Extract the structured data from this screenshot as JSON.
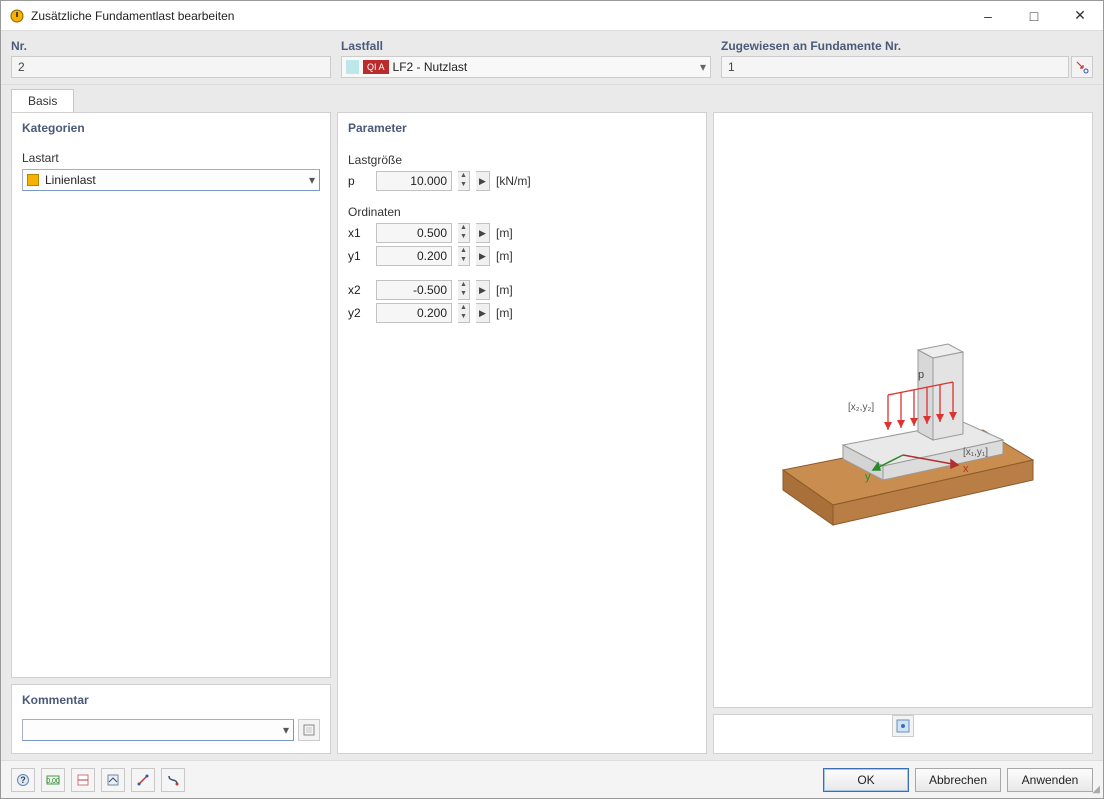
{
  "window": {
    "title": "Zusätzliche Fundamentlast bearbeiten"
  },
  "header": {
    "nr_label": "Nr.",
    "nr_value": "2",
    "lastfall_label": "Lastfall",
    "lastfall_badge": "QI A",
    "lastfall_value": "LF2 - Nutzlast",
    "assign_label": "Zugewiesen an Fundamente Nr.",
    "assign_value": "1"
  },
  "tabs": {
    "basis": "Basis"
  },
  "categories": {
    "heading": "Kategorien",
    "lastart_label": "Lastart",
    "lastart_value": "Linienlast"
  },
  "parameters": {
    "heading": "Parameter",
    "lastgroesse_label": "Lastgröße",
    "p_label": "p",
    "p_value": "10.000",
    "p_unit": "[kN/m]",
    "ordinaten_label": "Ordinaten",
    "x1_label": "x1",
    "x1_value": "0.500",
    "y1_label": "y1",
    "y1_value": "0.200",
    "x2_label": "x2",
    "x2_value": "-0.500",
    "y2_label": "y2",
    "y2_value": "0.200",
    "len_unit": "[m]"
  },
  "preview": {
    "p_label": "p",
    "p1_label": "[x₂,y₂]",
    "p2_label": "[x₁,y₁]",
    "y_axis": "y",
    "x_axis": "x"
  },
  "comment": {
    "heading": "Kommentar",
    "value": ""
  },
  "buttons": {
    "ok": "OK",
    "cancel": "Abbrechen",
    "apply": "Anwenden"
  }
}
